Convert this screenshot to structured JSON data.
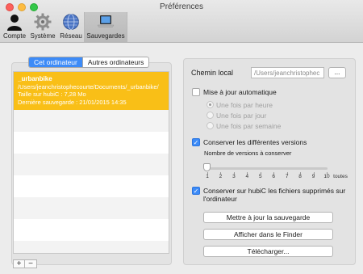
{
  "window": {
    "title": "Préférences"
  },
  "toolbar": {
    "items": [
      {
        "label": "Compte",
        "icon": "person-icon"
      },
      {
        "label": "Système",
        "icon": "gear-icon"
      },
      {
        "label": "Réseau",
        "icon": "globe-icon"
      },
      {
        "label": "Sauvegardes",
        "icon": "laptop-icon",
        "active": true
      }
    ]
  },
  "left": {
    "tabs": [
      {
        "label": "Cet ordinateur",
        "active": true
      },
      {
        "label": "Autres ordinateurs"
      }
    ],
    "backup_items": [
      {
        "name": "_urbanbike",
        "path": "/Users/jeanchristophecourte/Documents/_urbanbike/",
        "size": "Taille sur hubiC : 7,28 Mo",
        "last_backup": "Dernière sauvegarde : 21/01/2015 14:35"
      }
    ],
    "add_label": "+",
    "remove_label": "−"
  },
  "right": {
    "local_path_label": "Chemin local",
    "local_path_value": "/Users/jeanchristophec",
    "browse_label": "...",
    "auto_update_label": "Mise à jour automatique",
    "auto_update_checked": false,
    "frequency_options": [
      {
        "label": "Une fois par heure",
        "selected": true
      },
      {
        "label": "Une fois par jour",
        "selected": false
      },
      {
        "label": "Une fois par semaine",
        "selected": false
      }
    ],
    "keep_versions_label": "Conserver les différentes versions",
    "keep_versions_checked": true,
    "versions_count_label": "Nombre de versions à conserver",
    "versions_ticks": [
      "1",
      "2",
      "3",
      "4",
      "5",
      "6",
      "7",
      "8",
      "9",
      "10",
      "toutes"
    ],
    "versions_selected": "1",
    "keep_deleted_label_1": "Conserver sur hubiC les fichiers supprimés sur",
    "keep_deleted_label_2": "l'ordinateur",
    "keep_deleted_checked": true,
    "update_backup_button": "Mettre à jour la sauvegarde",
    "show_finder_button": "Afficher dans le Finder",
    "download_button": "Télécharger..."
  },
  "colors": {
    "accent": "#3d8bf7",
    "selection": "#f9bf17"
  }
}
